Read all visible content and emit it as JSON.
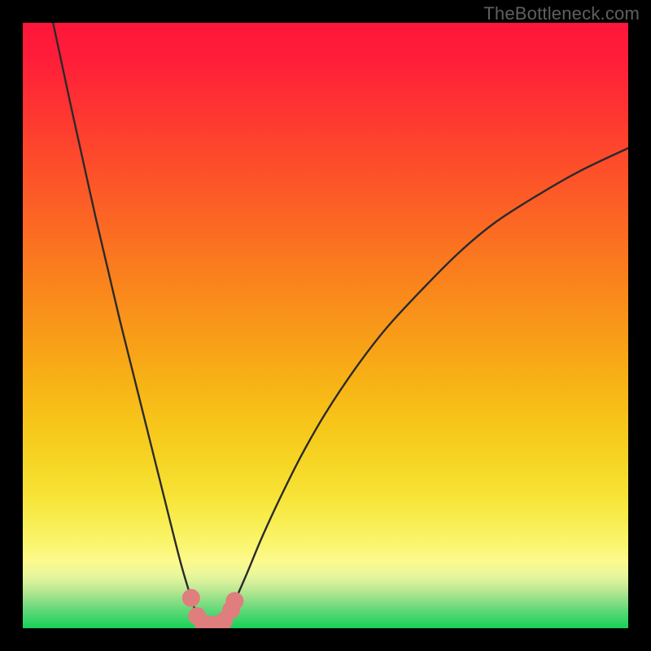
{
  "watermark": "TheBottleneck.com",
  "colors": {
    "frame": "#000000",
    "curve": "#2a2a2a",
    "marker": "#e07d7d",
    "watermark": "#5f5f5f",
    "gradient_stops": [
      {
        "offset": 0.0,
        "color": "#ff153b"
      },
      {
        "offset": 0.06,
        "color": "#ff1e39"
      },
      {
        "offset": 0.12,
        "color": "#ff2e34"
      },
      {
        "offset": 0.18,
        "color": "#fe3e2f"
      },
      {
        "offset": 0.24,
        "color": "#fd4f2a"
      },
      {
        "offset": 0.3,
        "color": "#fc5f26"
      },
      {
        "offset": 0.36,
        "color": "#fb7021"
      },
      {
        "offset": 0.42,
        "color": "#fa811d"
      },
      {
        "offset": 0.48,
        "color": "#f9921a"
      },
      {
        "offset": 0.54,
        "color": "#f8a317"
      },
      {
        "offset": 0.6,
        "color": "#f7b416"
      },
      {
        "offset": 0.66,
        "color": "#f7c51a"
      },
      {
        "offset": 0.72,
        "color": "#f6d423"
      },
      {
        "offset": 0.78,
        "color": "#f7e336"
      },
      {
        "offset": 0.82,
        "color": "#f8ed4f"
      },
      {
        "offset": 0.86,
        "color": "#faf56d"
      },
      {
        "offset": 0.889,
        "color": "#fcfa8d"
      },
      {
        "offset": 0.91,
        "color": "#ebf79a"
      },
      {
        "offset": 0.925,
        "color": "#d4ef9a"
      },
      {
        "offset": 0.938,
        "color": "#b8e893"
      },
      {
        "offset": 0.95,
        "color": "#98e189"
      },
      {
        "offset": 0.963,
        "color": "#76db7f"
      },
      {
        "offset": 0.976,
        "color": "#51d773"
      },
      {
        "offset": 1.0,
        "color": "#17d157"
      }
    ]
  },
  "chart_data": {
    "type": "line",
    "title": "",
    "xlabel": "",
    "ylabel": "",
    "xlim": [
      0,
      100
    ],
    "ylim": [
      0,
      100
    ],
    "series": [
      {
        "name": "bottleneck-curve-left",
        "x": [
          5.0,
          6.5,
          8.0,
          10.0,
          12.0,
          14.0,
          16.0,
          18.0,
          20.0,
          22.0,
          23.5,
          25.0,
          26.3,
          27.8,
          28.8
        ],
        "values": [
          100,
          93.0,
          86.0,
          77.0,
          68.0,
          59.5,
          51.0,
          43.0,
          35.0,
          27.0,
          21.0,
          15.0,
          10.0,
          5.0,
          2.0
        ]
      },
      {
        "name": "bottleneck-curve-right",
        "x": [
          33.5,
          35.0,
          37.0,
          39.5,
          42.5,
          46.0,
          50.0,
          55.0,
          60.0,
          66.0,
          72.0,
          78.0,
          85.0,
          92.0,
          100.0
        ],
        "values": [
          2.0,
          4.5,
          9.0,
          15.0,
          21.5,
          28.5,
          35.5,
          43.0,
          49.5,
          56.0,
          62.0,
          67.0,
          71.5,
          75.5,
          79.3
        ]
      }
    ],
    "ideal_zone_x": [
      28.8,
      33.5
    ],
    "markers": [
      {
        "x": 27.8,
        "y": 5.0
      },
      {
        "x": 28.8,
        "y": 2.0
      },
      {
        "x": 29.8,
        "y": 0.8
      },
      {
        "x": 31.5,
        "y": 0.6
      },
      {
        "x": 33.2,
        "y": 1.2
      },
      {
        "x": 34.4,
        "y": 3.0
      },
      {
        "x": 35.0,
        "y": 4.5
      }
    ]
  }
}
